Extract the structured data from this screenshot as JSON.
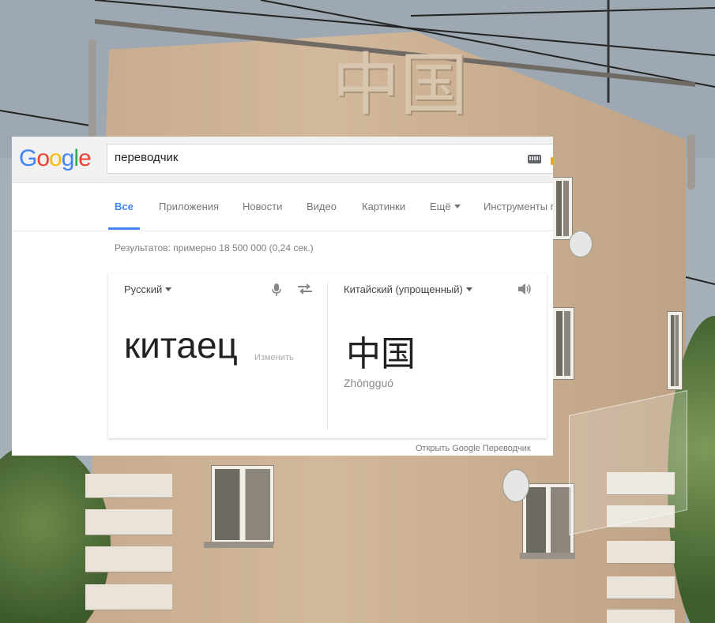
{
  "background": {
    "sign_text": "中国"
  },
  "google": {
    "logo_letters": [
      {
        "ch": "G",
        "color": "#4285f4"
      },
      {
        "ch": "o",
        "color": "#ea4335"
      },
      {
        "ch": "o",
        "color": "#fbbc05"
      },
      {
        "ch": "g",
        "color": "#4285f4"
      },
      {
        "ch": "l",
        "color": "#34a853"
      },
      {
        "ch": "e",
        "color": "#ea4335"
      }
    ],
    "search_query": "переводчик",
    "tabs": [
      {
        "label": "Все",
        "active": true
      },
      {
        "label": "Приложения"
      },
      {
        "label": "Новости"
      },
      {
        "label": "Видео"
      },
      {
        "label": "Картинки"
      },
      {
        "label": "Ещё"
      },
      {
        "label": "Инструменты поиска"
      }
    ],
    "results_count": "Результатов: примерно 18 500 000 (0,24 сек.)",
    "translator": {
      "source_lang": "Русский",
      "target_lang": "Китайский (упрощенный)",
      "source_text": "китаец",
      "edit_label": "Изменить",
      "target_text": "中国",
      "transliteration": "Zhōngguó",
      "open_link": "Открыть Google Переводчик"
    },
    "accent_color": "#4285f4"
  }
}
